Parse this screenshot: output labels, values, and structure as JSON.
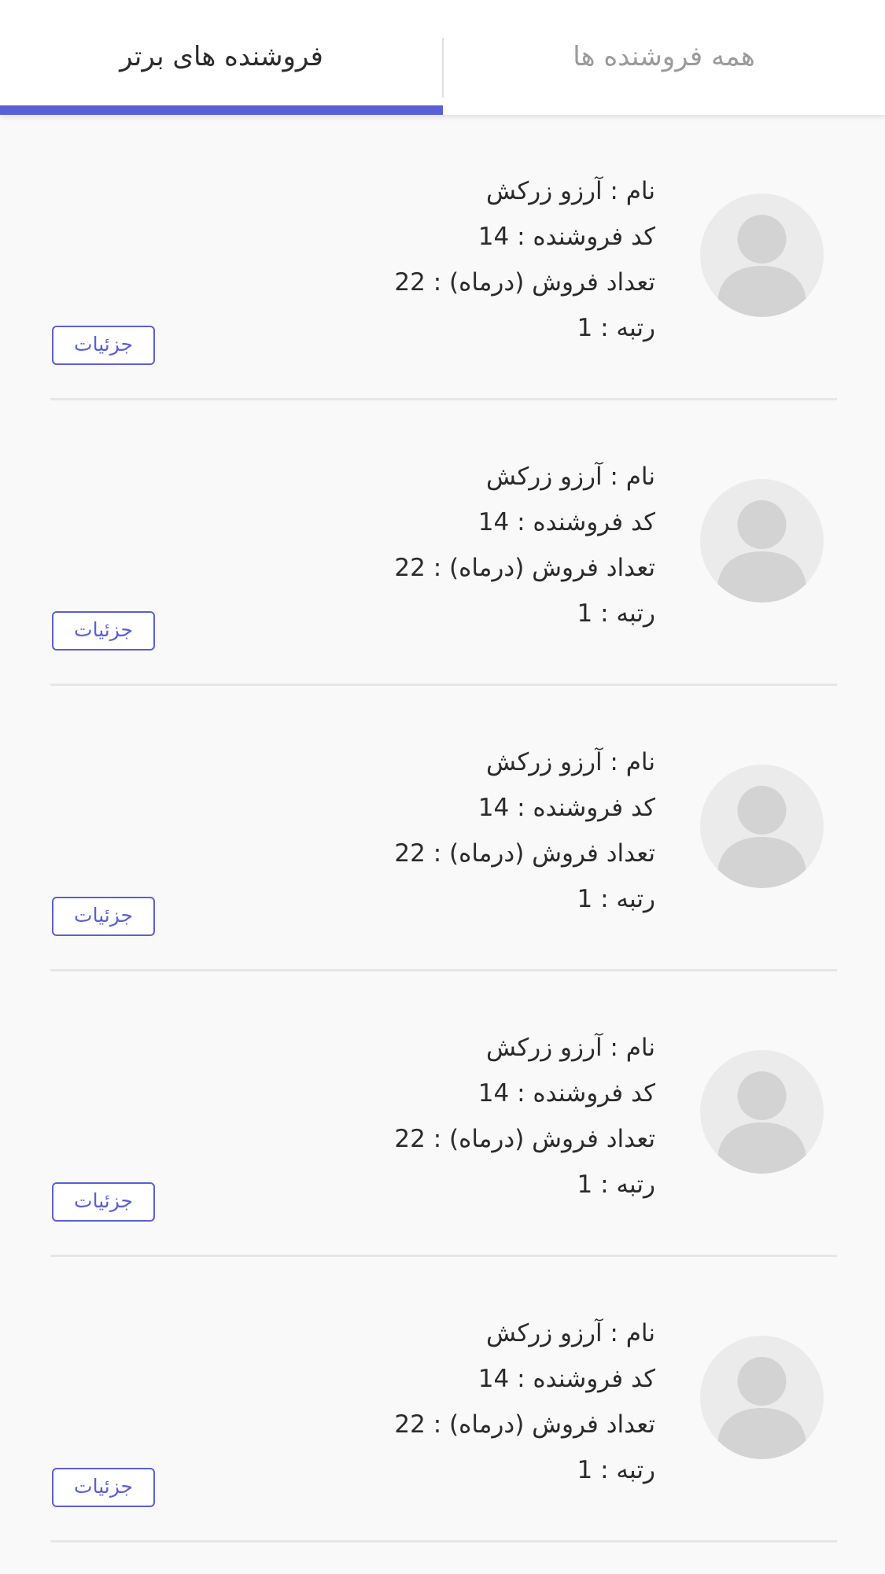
{
  "tabs": {
    "all_sellers": "همه فروشنده ها",
    "top_sellers": "فروشنده های برتر",
    "active": "top_sellers"
  },
  "colors": {
    "accent": "#5b5fd6",
    "background": "#f9f9f9",
    "avatar_bg": "#ebebeb",
    "avatar_fg": "#d3d3d3"
  },
  "sellers": [
    {
      "name_line": "نام : آرزو زرکش",
      "code_line": "کد فروشنده : 14",
      "sales_line": "تعداد فروش (درماه) : 22",
      "rank_line": "رتبه : 1",
      "details_label": "جزئیات",
      "avatar_icon": "user-icon"
    },
    {
      "name_line": "نام : آرزو زرکش",
      "code_line": "کد فروشنده : 14",
      "sales_line": "تعداد فروش (درماه) : 22",
      "rank_line": "رتبه : 1",
      "details_label": "جزئیات",
      "avatar_icon": "user-icon"
    },
    {
      "name_line": "نام : آرزو زرکش",
      "code_line": "کد فروشنده : 14",
      "sales_line": "تعداد فروش (درماه) : 22",
      "rank_line": "رتبه : 1",
      "details_label": "جزئیات",
      "avatar_icon": "user-icon"
    },
    {
      "name_line": "نام : آرزو زرکش",
      "code_line": "کد فروشنده : 14",
      "sales_line": "تعداد فروش (درماه) : 22",
      "rank_line": "رتبه : 1",
      "details_label": "جزئیات",
      "avatar_icon": "user-icon"
    },
    {
      "name_line": "نام : آرزو زرکش",
      "code_line": "کد فروشنده : 14",
      "sales_line": "تعداد فروش (درماه) : 22",
      "rank_line": "رتبه : 1",
      "details_label": "جزئیات",
      "avatar_icon": "user-icon"
    }
  ]
}
